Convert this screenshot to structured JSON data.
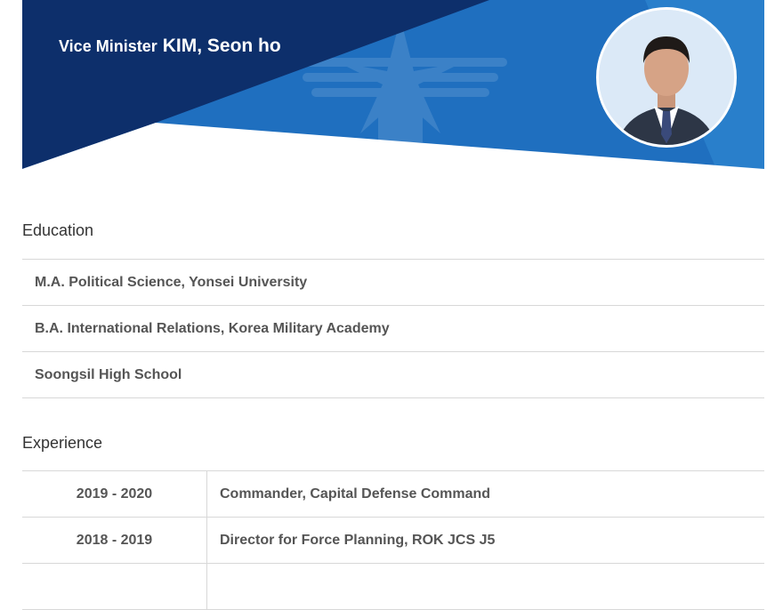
{
  "header": {
    "rank": "Vice Minister",
    "name": "KIM, Seon ho",
    "emblem_icon": "ministry-emblem-icon",
    "photo_icon": "portrait-photo",
    "colors": {
      "dark_navy": "#0d2f6b",
      "blue": "#1f6fbf",
      "light_blue": "#2e86d0"
    }
  },
  "education": {
    "title": "Education",
    "items": [
      "M.A. Political Science, Yonsei University",
      "B.A. International Relations, Korea Military Academy",
      "Soongsil High School"
    ]
  },
  "experience": {
    "title": "Experience",
    "items": [
      {
        "years": "2019 - 2020",
        "role": "Commander, Capital Defense Command"
      },
      {
        "years": "2018 - 2019",
        "role": "Director for Force Planning, ROK JCS J5"
      }
    ]
  }
}
